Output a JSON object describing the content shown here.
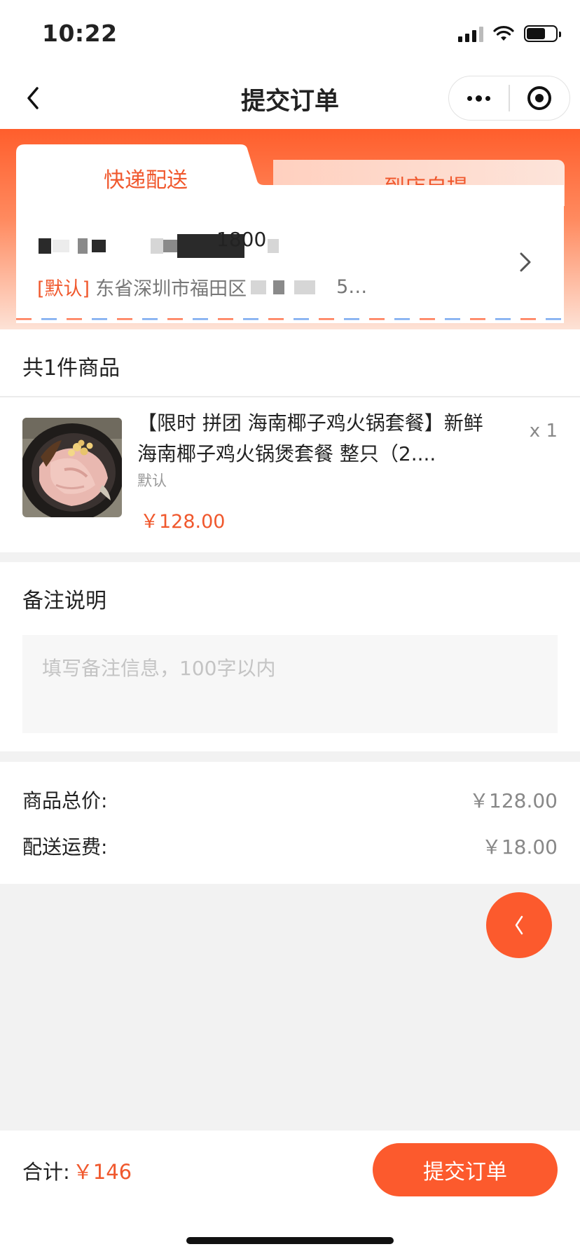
{
  "status_bar": {
    "time": "10:22"
  },
  "nav": {
    "title": "提交订单"
  },
  "delivery": {
    "tabs": [
      {
        "label": "快递配送",
        "active": true
      },
      {
        "label": "到店自提",
        "active": false
      }
    ],
    "address": {
      "name_visible": "1800",
      "default_tag": "[默认]",
      "detail_visible": "东省深圳市福田区",
      "detail_tail": "5…"
    }
  },
  "goods": {
    "count_label": "共1件商品",
    "item": {
      "title": "【限时 拼团 海南椰子鸡火锅套餐】新鲜海南椰子鸡火锅煲套餐 整只（2....",
      "spec": "默认",
      "price": "￥128.00",
      "qty": "x 1"
    }
  },
  "remark": {
    "label": "备注说明",
    "placeholder": "填写备注信息，100字以内"
  },
  "summary": {
    "goods_total_label": "商品总价:",
    "goods_total_value": "￥128.00",
    "shipping_label": "配送运费:",
    "shipping_value": "￥18.00"
  },
  "bottom": {
    "total_label": "合计:",
    "total_value": "￥146",
    "submit_label": "提交订单"
  },
  "colors": {
    "accent": "#fc5a2d",
    "accent_text": "#f0582d"
  }
}
